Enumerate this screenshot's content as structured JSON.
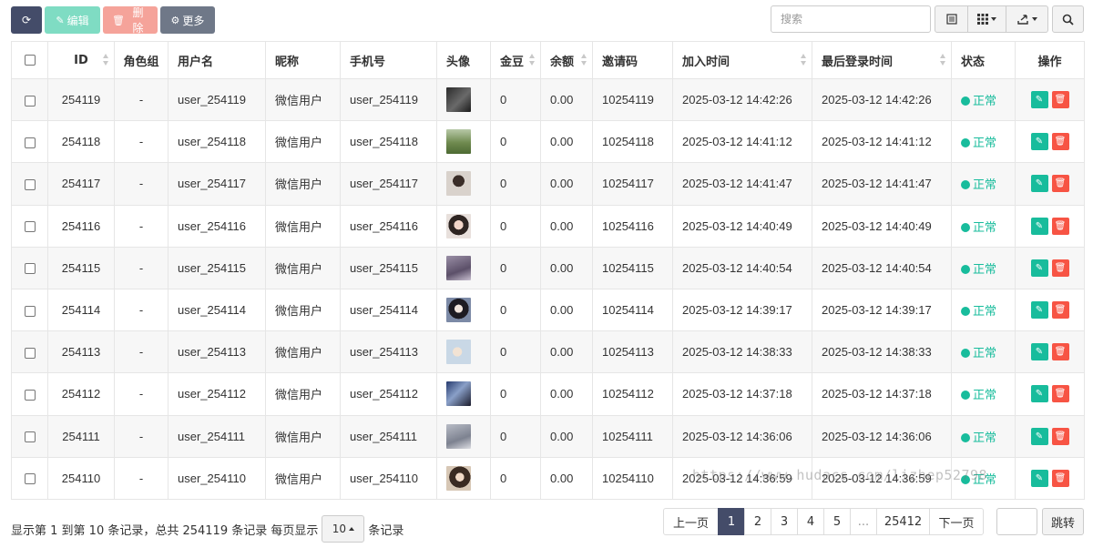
{
  "toolbar": {
    "edit_label": "编辑",
    "delete_label": "删除",
    "more_label": "更多"
  },
  "search": {
    "placeholder": "搜索"
  },
  "columns": [
    "ID",
    "角色组",
    "用户名",
    "昵称",
    "手机号",
    "头像",
    "金豆",
    "余额",
    "邀请码",
    "加入时间",
    "最后登录时间",
    "状态",
    "操作"
  ],
  "rows": [
    {
      "id": "254119",
      "group": "-",
      "username": "user_254119",
      "nickname": "微信用户",
      "mobile": "user_254119",
      "gold": "0",
      "balance": "0.00",
      "invite": "10254119",
      "join_time": "2025-03-12 14:42:26",
      "login_time": "2025-03-12 14:42:26",
      "status": "正常"
    },
    {
      "id": "254118",
      "group": "-",
      "username": "user_254118",
      "nickname": "微信用户",
      "mobile": "user_254118",
      "gold": "0",
      "balance": "0.00",
      "invite": "10254118",
      "join_time": "2025-03-12 14:41:12",
      "login_time": "2025-03-12 14:41:12",
      "status": "正常"
    },
    {
      "id": "254117",
      "group": "-",
      "username": "user_254117",
      "nickname": "微信用户",
      "mobile": "user_254117",
      "gold": "0",
      "balance": "0.00",
      "invite": "10254117",
      "join_time": "2025-03-12 14:41:47",
      "login_time": "2025-03-12 14:41:47",
      "status": "正常"
    },
    {
      "id": "254116",
      "group": "-",
      "username": "user_254116",
      "nickname": "微信用户",
      "mobile": "user_254116",
      "gold": "0",
      "balance": "0.00",
      "invite": "10254116",
      "join_time": "2025-03-12 14:40:49",
      "login_time": "2025-03-12 14:40:49",
      "status": "正常"
    },
    {
      "id": "254115",
      "group": "-",
      "username": "user_254115",
      "nickname": "微信用户",
      "mobile": "user_254115",
      "gold": "0",
      "balance": "0.00",
      "invite": "10254115",
      "join_time": "2025-03-12 14:40:54",
      "login_time": "2025-03-12 14:40:54",
      "status": "正常"
    },
    {
      "id": "254114",
      "group": "-",
      "username": "user_254114",
      "nickname": "微信用户",
      "mobile": "user_254114",
      "gold": "0",
      "balance": "0.00",
      "invite": "10254114",
      "join_time": "2025-03-12 14:39:17",
      "login_time": "2025-03-12 14:39:17",
      "status": "正常"
    },
    {
      "id": "254113",
      "group": "-",
      "username": "user_254113",
      "nickname": "微信用户",
      "mobile": "user_254113",
      "gold": "0",
      "balance": "0.00",
      "invite": "10254113",
      "join_time": "2025-03-12 14:38:33",
      "login_time": "2025-03-12 14:38:33",
      "status": "正常"
    },
    {
      "id": "254112",
      "group": "-",
      "username": "user_254112",
      "nickname": "微信用户",
      "mobile": "user_254112",
      "gold": "0",
      "balance": "0.00",
      "invite": "10254112",
      "join_time": "2025-03-12 14:37:18",
      "login_time": "2025-03-12 14:37:18",
      "status": "正常"
    },
    {
      "id": "254111",
      "group": "-",
      "username": "user_254111",
      "nickname": "微信用户",
      "mobile": "user_254111",
      "gold": "0",
      "balance": "0.00",
      "invite": "10254111",
      "join_time": "2025-03-12 14:36:06",
      "login_time": "2025-03-12 14:36:06",
      "status": "正常"
    },
    {
      "id": "254110",
      "group": "-",
      "username": "user_254110",
      "nickname": "微信用户",
      "mobile": "user_254110",
      "gold": "0",
      "balance": "0.00",
      "invite": "10254110",
      "join_time": "2025-03-12 14:36:59",
      "login_time": "2025-03-12 14:36:59",
      "status": "正常"
    }
  ],
  "footer": {
    "summary_prefix": "显示第 1 到第 10 条记录，总共 254119 条记录 每页显示",
    "page_size": "10",
    "summary_suffix": "条记录"
  },
  "pagination": {
    "prev": "上一页",
    "pages": [
      "1",
      "2",
      "3",
      "4",
      "5"
    ],
    "active": "1",
    "dots": "...",
    "last": "25412",
    "next": "下一页",
    "jump": "跳转"
  },
  "watermark": "https://www.hudacs.com/lizhep52798",
  "colors": {
    "primary": "#444c69",
    "success": "#18bc9c",
    "danger": "#f75444"
  }
}
